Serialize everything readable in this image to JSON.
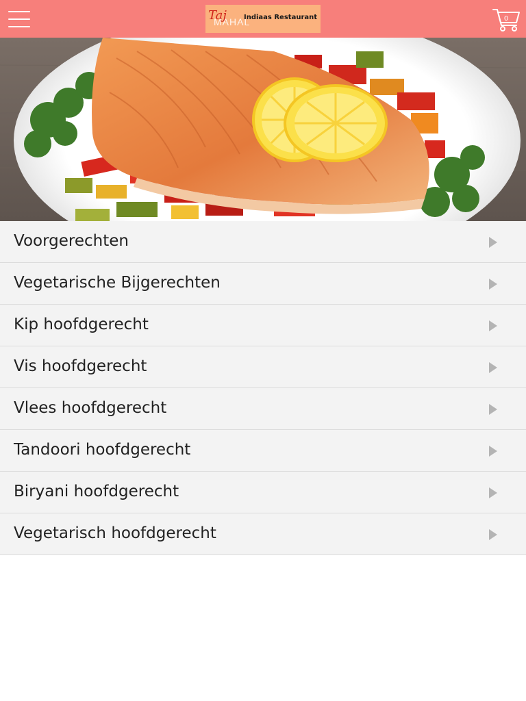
{
  "header": {
    "menu_icon": "hamburger-icon",
    "logo": {
      "taj": "Taj",
      "mahal": "MAHAL",
      "tagline": "Indiaas Restaurant"
    },
    "cart": {
      "icon": "cart-icon",
      "count": "0"
    },
    "bg_color": "#f77f7b"
  },
  "hero": {
    "alt": "salmon-dish-image"
  },
  "categories": [
    {
      "label": "Voorgerechten",
      "icon": "chevron-right-icon"
    },
    {
      "label": "Vegetarische Bijgerechten",
      "icon": "chevron-right-icon"
    },
    {
      "label": "Kip hoofdgerecht",
      "icon": "chevron-right-icon"
    },
    {
      "label": "Vis hoofdgerecht",
      "icon": "chevron-right-icon"
    },
    {
      "label": "Vlees hoofdgerecht",
      "icon": "chevron-right-icon"
    },
    {
      "label": "Tandoori hoofdgerecht",
      "icon": "chevron-right-icon"
    },
    {
      "label": "Biryani hoofdgerecht",
      "icon": "chevron-right-icon"
    },
    {
      "label": "Vegetarisch hoofdgerecht",
      "icon": "chevron-right-icon"
    }
  ]
}
